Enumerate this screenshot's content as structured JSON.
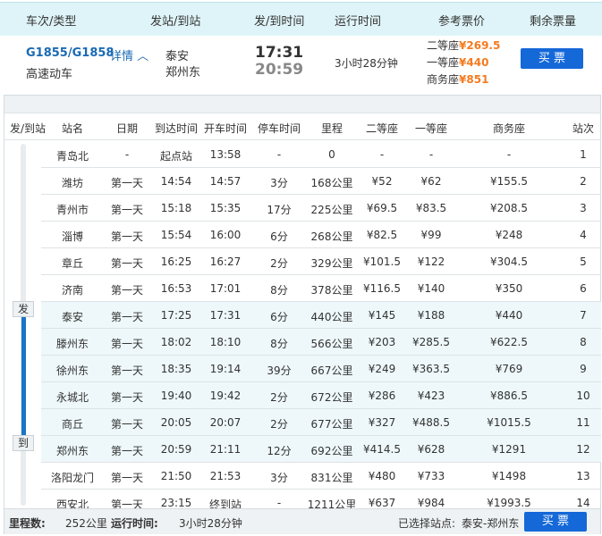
{
  "header": {
    "cols": [
      "车次/类型",
      "发站/到站",
      "发/到时间",
      "运行时间",
      "参考票价",
      "剩余票量"
    ]
  },
  "train": {
    "number": "G1855/G1858",
    "details_link": "详情",
    "type": "高速动车",
    "from": "泰安",
    "to": "郑州东",
    "depart": "17:31",
    "arrive": "20:59",
    "duration": "3小时28分钟",
    "prices": [
      {
        "seat": "二等座",
        "price": "¥269.5"
      },
      {
        "seat": "一等座",
        "price": "¥440"
      },
      {
        "seat": "商务座",
        "price": "¥851"
      }
    ],
    "buy_label": "买 票"
  },
  "stops_header": [
    "发/到站",
    "站名",
    "日期",
    "到达时间",
    "开车时间",
    "停车时间",
    "里程",
    "二等座",
    "一等座",
    "商务座",
    "站次"
  ],
  "markers": {
    "depart": "发",
    "arrive": "到"
  },
  "stops": [
    [
      "青岛北",
      "-",
      "起点站",
      "13:58",
      "-",
      "0",
      "-",
      "-",
      "-",
      "1"
    ],
    [
      "潍坊",
      "第一天",
      "14:54",
      "14:57",
      "3分",
      "168公里",
      "¥52",
      "¥62",
      "¥155.5",
      "2"
    ],
    [
      "青州市",
      "第一天",
      "15:18",
      "15:35",
      "17分",
      "225公里",
      "¥69.5",
      "¥83.5",
      "¥208.5",
      "3"
    ],
    [
      "淄博",
      "第一天",
      "15:54",
      "16:00",
      "6分",
      "268公里",
      "¥82.5",
      "¥99",
      "¥248",
      "4"
    ],
    [
      "章丘",
      "第一天",
      "16:25",
      "16:27",
      "2分",
      "329公里",
      "¥101.5",
      "¥122",
      "¥304.5",
      "5"
    ],
    [
      "济南",
      "第一天",
      "16:53",
      "17:01",
      "8分",
      "378公里",
      "¥116.5",
      "¥140",
      "¥350",
      "6"
    ],
    [
      "泰安",
      "第一天",
      "17:25",
      "17:31",
      "6分",
      "440公里",
      "¥145",
      "¥188",
      "¥440",
      "7"
    ],
    [
      "滕州东",
      "第一天",
      "18:02",
      "18:10",
      "8分",
      "566公里",
      "¥203",
      "¥285.5",
      "¥622.5",
      "8"
    ],
    [
      "徐州东",
      "第一天",
      "18:35",
      "19:14",
      "39分",
      "667公里",
      "¥249",
      "¥363.5",
      "¥769",
      "9"
    ],
    [
      "永城北",
      "第一天",
      "19:40",
      "19:42",
      "2分",
      "672公里",
      "¥286",
      "¥423",
      "¥886.5",
      "10"
    ],
    [
      "商丘",
      "第一天",
      "20:05",
      "20:07",
      "2分",
      "677公里",
      "¥327",
      "¥488.5",
      "¥1015.5",
      "11"
    ],
    [
      "郑州东",
      "第一天",
      "20:59",
      "21:11",
      "12分",
      "692公里",
      "¥414.5",
      "¥628",
      "¥1291",
      "12"
    ],
    [
      "洛阳龙门",
      "第一天",
      "21:50",
      "21:53",
      "3分",
      "831公里",
      "¥480",
      "¥733",
      "¥1498",
      "13"
    ],
    [
      "西安北",
      "第一天",
      "23:15",
      "终到站",
      "-",
      "1211公里",
      "¥637",
      "¥984",
      "¥1993.5",
      "14"
    ]
  ],
  "footer": {
    "distance_label": "里程数:",
    "distance": "252公里",
    "time_label": "运行时间:",
    "time": "3小时28分钟",
    "selected_label": "已选择站点:",
    "selected": "泰安-郑州东",
    "buy_label": "买 票"
  }
}
